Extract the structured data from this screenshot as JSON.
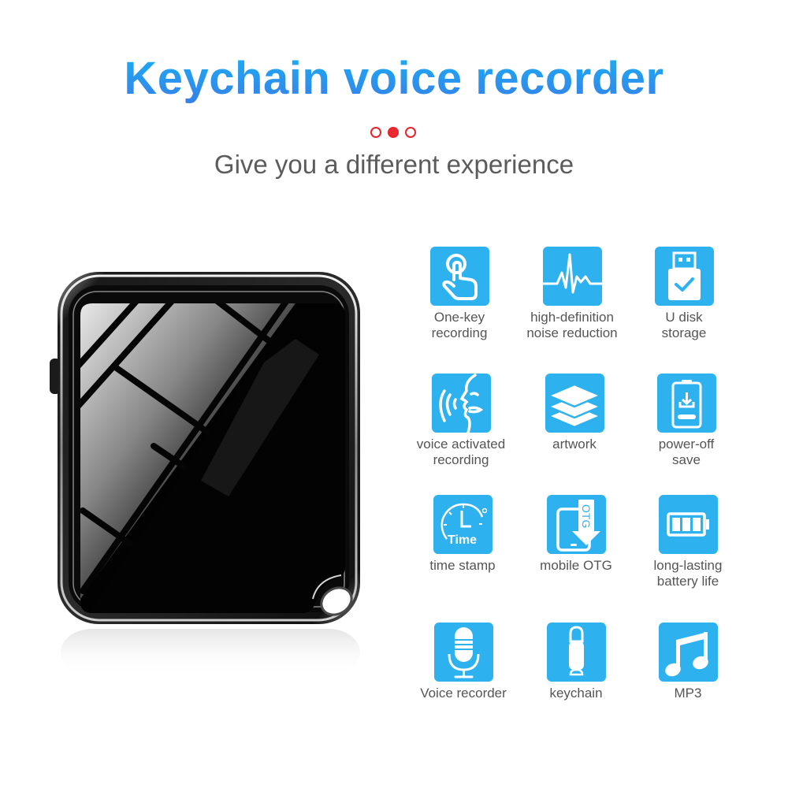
{
  "header": {
    "title": "Keychain voice recorder",
    "subtitle": "Give you a different experience",
    "indicator": {
      "count": 3,
      "active_index": 1,
      "color": "#ea2a2e"
    }
  },
  "colors": {
    "title_gradient_top": "#16b4f4",
    "title_gradient_bottom": "#3a7ce6",
    "icon_tile": "#2db1ef",
    "label_text": "#555555",
    "subtitle_text": "#5c5c5c"
  },
  "product": {
    "name": "keychain voice recorder device",
    "finish": "glossy black"
  },
  "features": [
    {
      "icon": "touch-finger-icon",
      "line1": "One-key",
      "line2": "recording"
    },
    {
      "icon": "waveform-icon",
      "line1": "high-definition",
      "line2": "noise reduction"
    },
    {
      "icon": "usb-drive-check-icon",
      "line1": "U disk",
      "line2": "storage"
    },
    {
      "icon": "voice-speaking-icon",
      "line1": "voice activated",
      "line2": "recording"
    },
    {
      "icon": "layers-icon",
      "line1": "artwork",
      "line2": ""
    },
    {
      "icon": "battery-save-icon",
      "line1": "power-off",
      "line2": "save"
    },
    {
      "icon": "clock-time-icon",
      "line1": "time stamp",
      "line2": "",
      "icon_text": "Time"
    },
    {
      "icon": "phone-otg-icon",
      "line1": "mobile OTG",
      "line2": "",
      "icon_text": "OTG"
    },
    {
      "icon": "battery-full-icon",
      "line1": "long-lasting",
      "line2": "battery life"
    },
    {
      "icon": "microphone-icon",
      "line1": "Voice recorder",
      "line2": ""
    },
    {
      "icon": "keychain-icon",
      "line1": "keychain",
      "line2": ""
    },
    {
      "icon": "music-note-icon",
      "line1": "MP3",
      "line2": ""
    }
  ]
}
